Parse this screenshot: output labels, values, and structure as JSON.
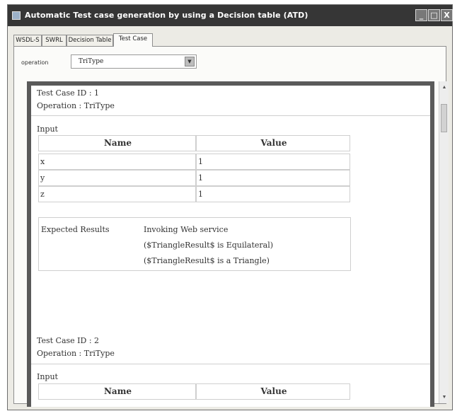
{
  "window": {
    "title": "Automatic Test case generation by using a Decision table (ATD)",
    "buttons": {
      "minimize": "_",
      "maximize": "□",
      "close": "X"
    }
  },
  "tabs": [
    {
      "label": "WSDL-S",
      "active": false
    },
    {
      "label": "SWRL",
      "active": false
    },
    {
      "label": "Decision Table",
      "active": false
    },
    {
      "label": "Test Case",
      "active": true
    }
  ],
  "operation": {
    "label": "operation",
    "selected": "TriType"
  },
  "table_headers": {
    "name": "Name",
    "value": "Value"
  },
  "test_cases": [
    {
      "id_line": "Test Case ID : 1",
      "operation_line": "Operation : TriType",
      "input_label": "Input",
      "rows": [
        {
          "name": "x",
          "value": "1"
        },
        {
          "name": "y",
          "value": "1"
        },
        {
          "name": "z",
          "value": "1"
        }
      ],
      "expected_label": "Expected Results",
      "expected_lines": [
        "Invoking Web service",
        "($TriangleResult$ is Equilateral)",
        "($TriangleResult$ is a Triangle)"
      ]
    },
    {
      "id_line": "Test Case ID : 2",
      "operation_line": "Operation : TriType",
      "input_label": "Input"
    }
  ]
}
